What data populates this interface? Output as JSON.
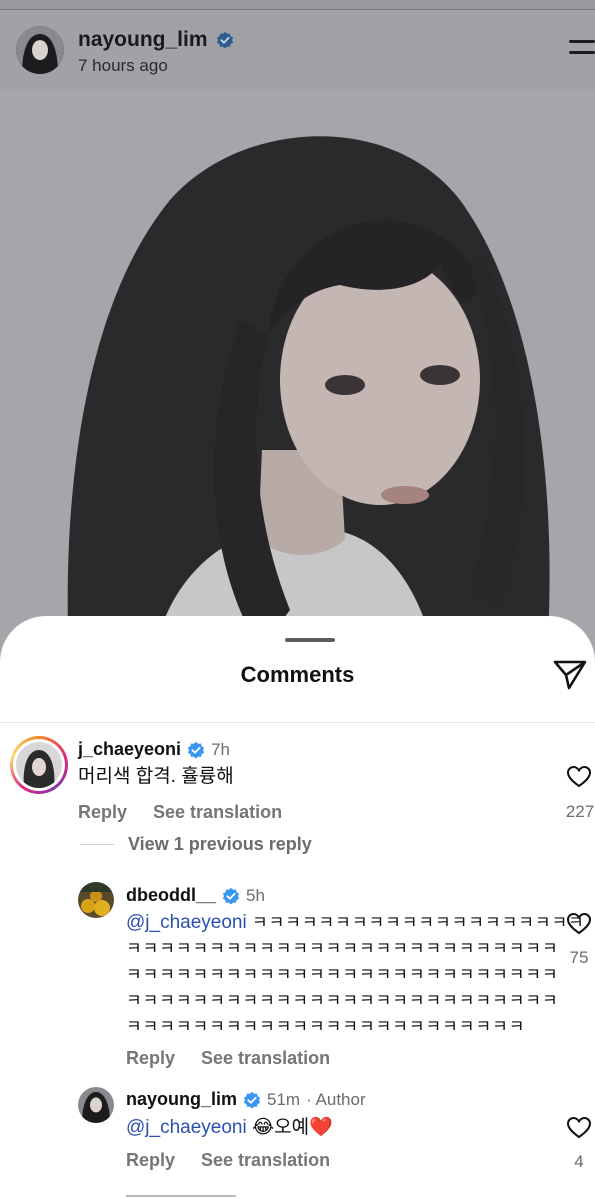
{
  "post": {
    "username": "nayoung_lim",
    "time": "7 hours ago"
  },
  "sheet": {
    "title": "Comments"
  },
  "comments": [
    {
      "username": "j_chaeyeoni",
      "time": "7h",
      "text": "머리색 합격. 휼륭해",
      "actions": {
        "reply": "Reply",
        "translate": "See translation"
      },
      "likes": "227"
    },
    {
      "username": "dbeoddl__",
      "time": "5h",
      "mention": "@j_chaeyeoni",
      "laugh_lines": [
        "ㅋㅋㅋㅋㅋㅋㅋㅋㅋㅋㅋㅋㅋㅋㅋㅋㅋㅋㅋㅋ",
        "ㅋㅋㅋㅋㅋㅋㅋㅋㅋㅋㅋㅋㅋㅋㅋㅋㅋㅋㅋㅋㅋㅋㅋㅋㅋㅋ",
        "ㅋㅋㅋㅋㅋㅋㅋㅋㅋㅋㅋㅋㅋㅋㅋㅋㅋㅋㅋㅋㅋㅋㅋㅋㅋㅋ",
        "ㅋㅋㅋㅋㅋㅋㅋㅋㅋㅋㅋㅋㅋㅋㅋㅋㅋㅋㅋㅋㅋㅋㅋㅋㅋㅋ",
        "ㅋㅋㅋㅋㅋㅋㅋㅋㅋㅋㅋㅋㅋㅋㅋㅋㅋㅋㅋㅋㅋㅋㅋㅋ"
      ],
      "actions": {
        "reply": "Reply",
        "translate": "See translation"
      },
      "likes": "75"
    },
    {
      "username": "nayoung_lim",
      "time": "51m",
      "author_tag": "· Author",
      "mention": "@j_chaeyeoni",
      "text": "😂오예❤️",
      "actions": {
        "reply": "Reply",
        "translate": "See translation"
      },
      "likes": "4"
    }
  ],
  "view_previous": "View 1 previous reply",
  "colors": {
    "verified": "#3897f0",
    "mention": "#2d4fb4",
    "dim_overlay": "#9b9b9f"
  },
  "icons": [
    "verified-badge-icon",
    "menu-icon",
    "share-icon",
    "heart-icon"
  ]
}
